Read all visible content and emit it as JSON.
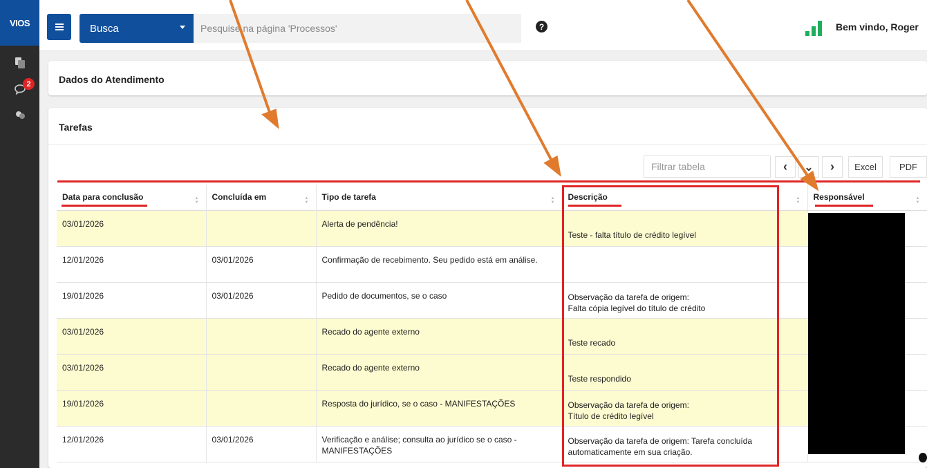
{
  "app": {
    "logo": "VIOS",
    "chat_badge": "2"
  },
  "header": {
    "search_mode": "Busca",
    "search_placeholder": "Pesquise na página 'Processos'",
    "help": "?",
    "welcome": "Bem vindo, Roger"
  },
  "sections": {
    "atendimento_title": "Dados do Atendimento",
    "tarefas_title": "Tarefas"
  },
  "toolbar": {
    "filter_placeholder": "Filtrar tabela",
    "prev": "‹",
    "toggle": "⌄",
    "next": "›",
    "excel": "Excel",
    "pdf": "PDF"
  },
  "table": {
    "headers": [
      "Data para conclusão",
      "Concluída em",
      "Tipo de tarefa",
      "Descrição",
      "Responsável"
    ],
    "rows": [
      {
        "due": "03/01/2026",
        "done": "",
        "type": "Alerta de pendência!",
        "desc": [
          "Teste - falta título de crédito legível"
        ]
      },
      {
        "due": "12/01/2026",
        "done": "03/01/2026",
        "type": "Confirmação de recebimento. Seu pedido está em análise.",
        "desc": []
      },
      {
        "due": "19/01/2026",
        "done": "03/01/2026",
        "type": "Pedido de documentos, se o caso",
        "desc": [
          "Observação da tarefa de origem:",
          "Falta cópia legível do título de crédito"
        ]
      },
      {
        "due": "03/01/2026",
        "done": "",
        "type": "Recado do agente externo",
        "desc": [
          "Teste recado"
        ]
      },
      {
        "due": "03/01/2026",
        "done": "",
        "type": "Recado do agente externo",
        "desc": [
          "Teste respondido"
        ]
      },
      {
        "due": "19/01/2026",
        "done": "",
        "type": "Resposta do jurídico, se o caso - MANIFESTAÇÕES",
        "desc": [
          "Observação da tarefa de origem:",
          "Título de crédito legível"
        ]
      },
      {
        "due": "12/01/2026",
        "done": "03/01/2026",
        "type": "Verificação e análise; consulta ao jurídico se o caso - MANIFESTAÇÕES",
        "desc": [
          "Observação da tarefa de origem: Tarefa concluída",
          "automaticamente em sua criação."
        ]
      }
    ]
  },
  "colors": {
    "brand_blue": "#104f9c",
    "highlight_row": "#fdfbd0",
    "annotation_red": "#e02424",
    "annotation_arrow": "#e07b2e",
    "signal_green": "#1fae5e"
  }
}
